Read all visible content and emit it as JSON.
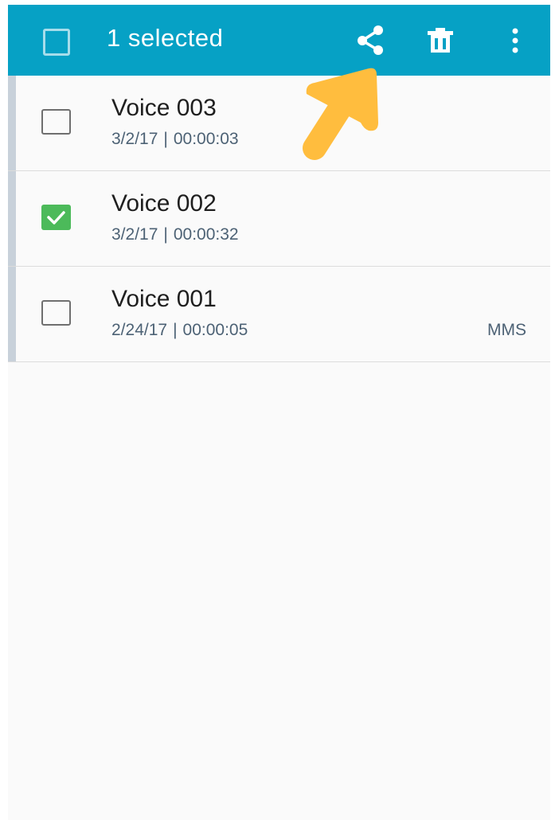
{
  "toolbar": {
    "selected_label": "1 selected",
    "background_color": "#06a1c5",
    "icons": [
      "checkbox-outline-icon",
      "share-icon",
      "trash-icon",
      "more-vert-icon"
    ]
  },
  "recordings": [
    {
      "name": "Voice 003",
      "date": "3/2/17",
      "separator": "|",
      "duration": "00:00:03",
      "tag": "",
      "checked": false
    },
    {
      "name": "Voice 002",
      "date": "3/2/17",
      "separator": "|",
      "duration": "00:00:32",
      "tag": "",
      "checked": true
    },
    {
      "name": "Voice 001",
      "date": "2/24/17",
      "separator": "|",
      "duration": "00:00:05",
      "tag": "MMS",
      "checked": false
    }
  ],
  "colors": {
    "checked": "#4cba5a",
    "meta_text": "#4d6275",
    "annotation_arrow": "#ffbd3e"
  }
}
